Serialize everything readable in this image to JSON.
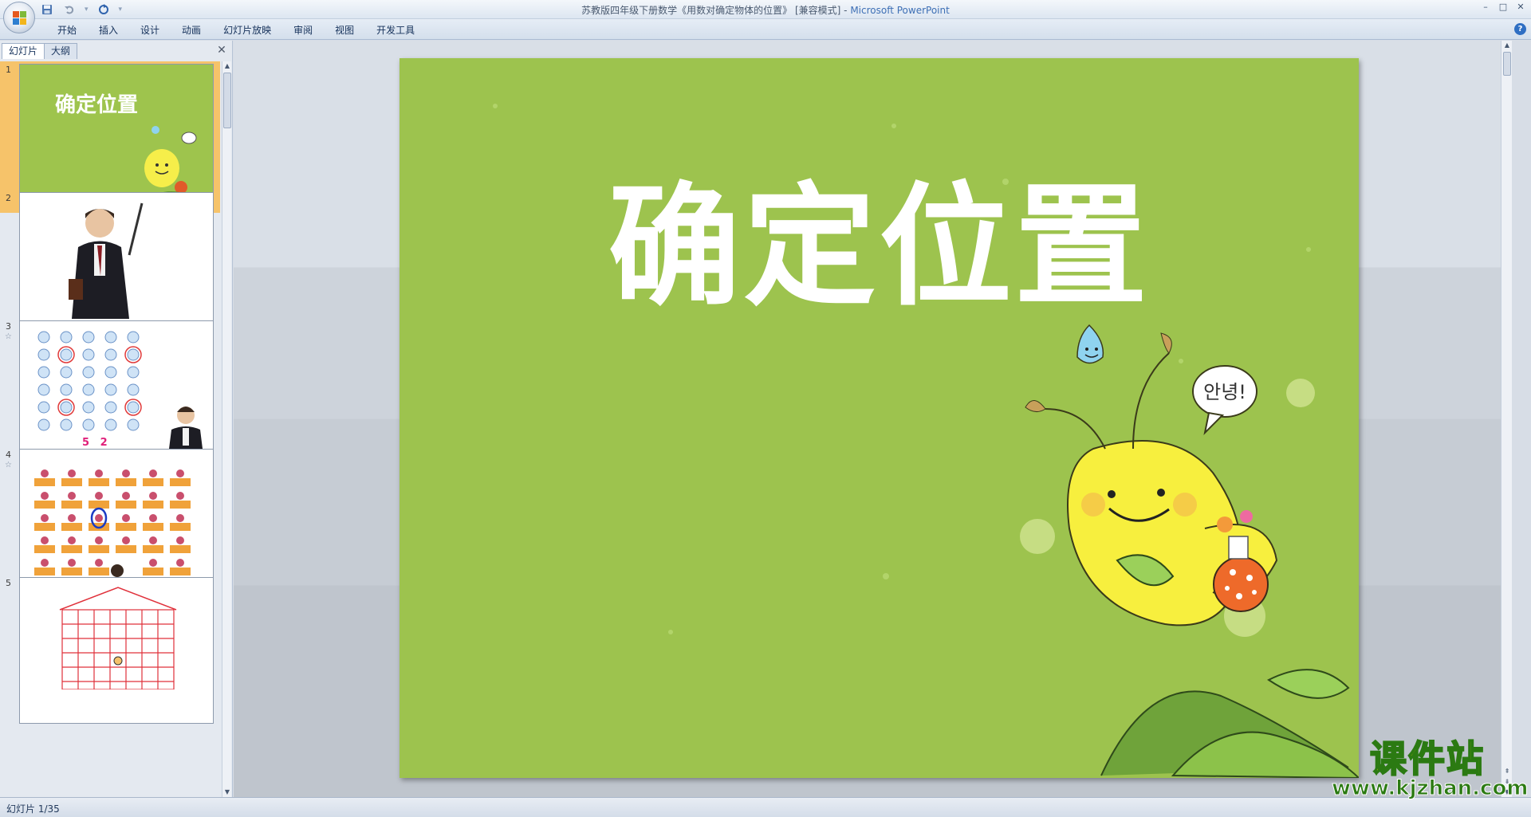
{
  "window": {
    "title": "苏教版四年级下册数学《用数对确定物体的位置》 [兼容模式] - ",
    "app_name": "Microsoft PowerPoint",
    "controls": [
      "–",
      "□",
      "✕"
    ]
  },
  "quick_access": {
    "save_icon": "save-icon",
    "undo_icon": "undo-icon",
    "redo_icon": "redo-icon"
  },
  "ribbon": {
    "tabs": [
      "开始",
      "插入",
      "设计",
      "动画",
      "幻灯片放映",
      "审阅",
      "视图",
      "开发工具"
    ],
    "help": "?"
  },
  "panel": {
    "tabs": [
      "幻灯片",
      "大纲"
    ],
    "close": "✕",
    "thumbnails": [
      {
        "number": "1",
        "title": "确定位置",
        "selected": true
      },
      {
        "number": "2"
      },
      {
        "number": "3",
        "caption": "5   2"
      },
      {
        "number": "4"
      },
      {
        "number": "5"
      }
    ]
  },
  "slide": {
    "title": "确定位置",
    "background": "#9dc34e",
    "speech_bubble": "안녕!"
  },
  "status": {
    "text": "幻灯片 1/35"
  },
  "watermark": {
    "top": "课件站",
    "bottom": "www.kjzhan.com"
  }
}
